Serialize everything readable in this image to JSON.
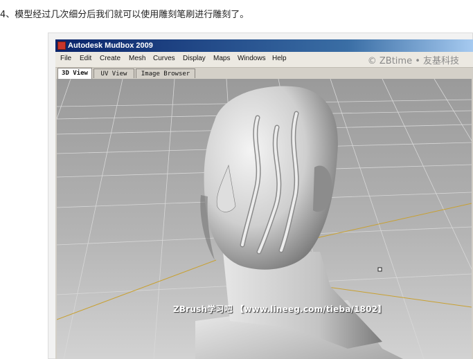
{
  "caption": "4、模型经过几次细分后我们就可以使用雕刻笔刷进行雕刻了。",
  "window": {
    "title": "Autodesk Mudbox 2009"
  },
  "menu": {
    "items": [
      "File",
      "Edit",
      "Create",
      "Mesh",
      "Curves",
      "Display",
      "Maps",
      "Windows",
      "Help"
    ]
  },
  "credit": "© ZBtime • 友基科技",
  "tabs": [
    {
      "label": "3D View",
      "active": true
    },
    {
      "label": "UV View",
      "active": false
    },
    {
      "label": "Image Browser",
      "active": false
    }
  ],
  "watermark": "ZBrush学习吧 【www.lineeg.com/tieba/1802】",
  "colors": {
    "titlebar": "#0a246a",
    "viewport_top": "#9a9a9a",
    "viewport_bottom": "#cfcfcf",
    "grid_axis": "#c8a030"
  }
}
